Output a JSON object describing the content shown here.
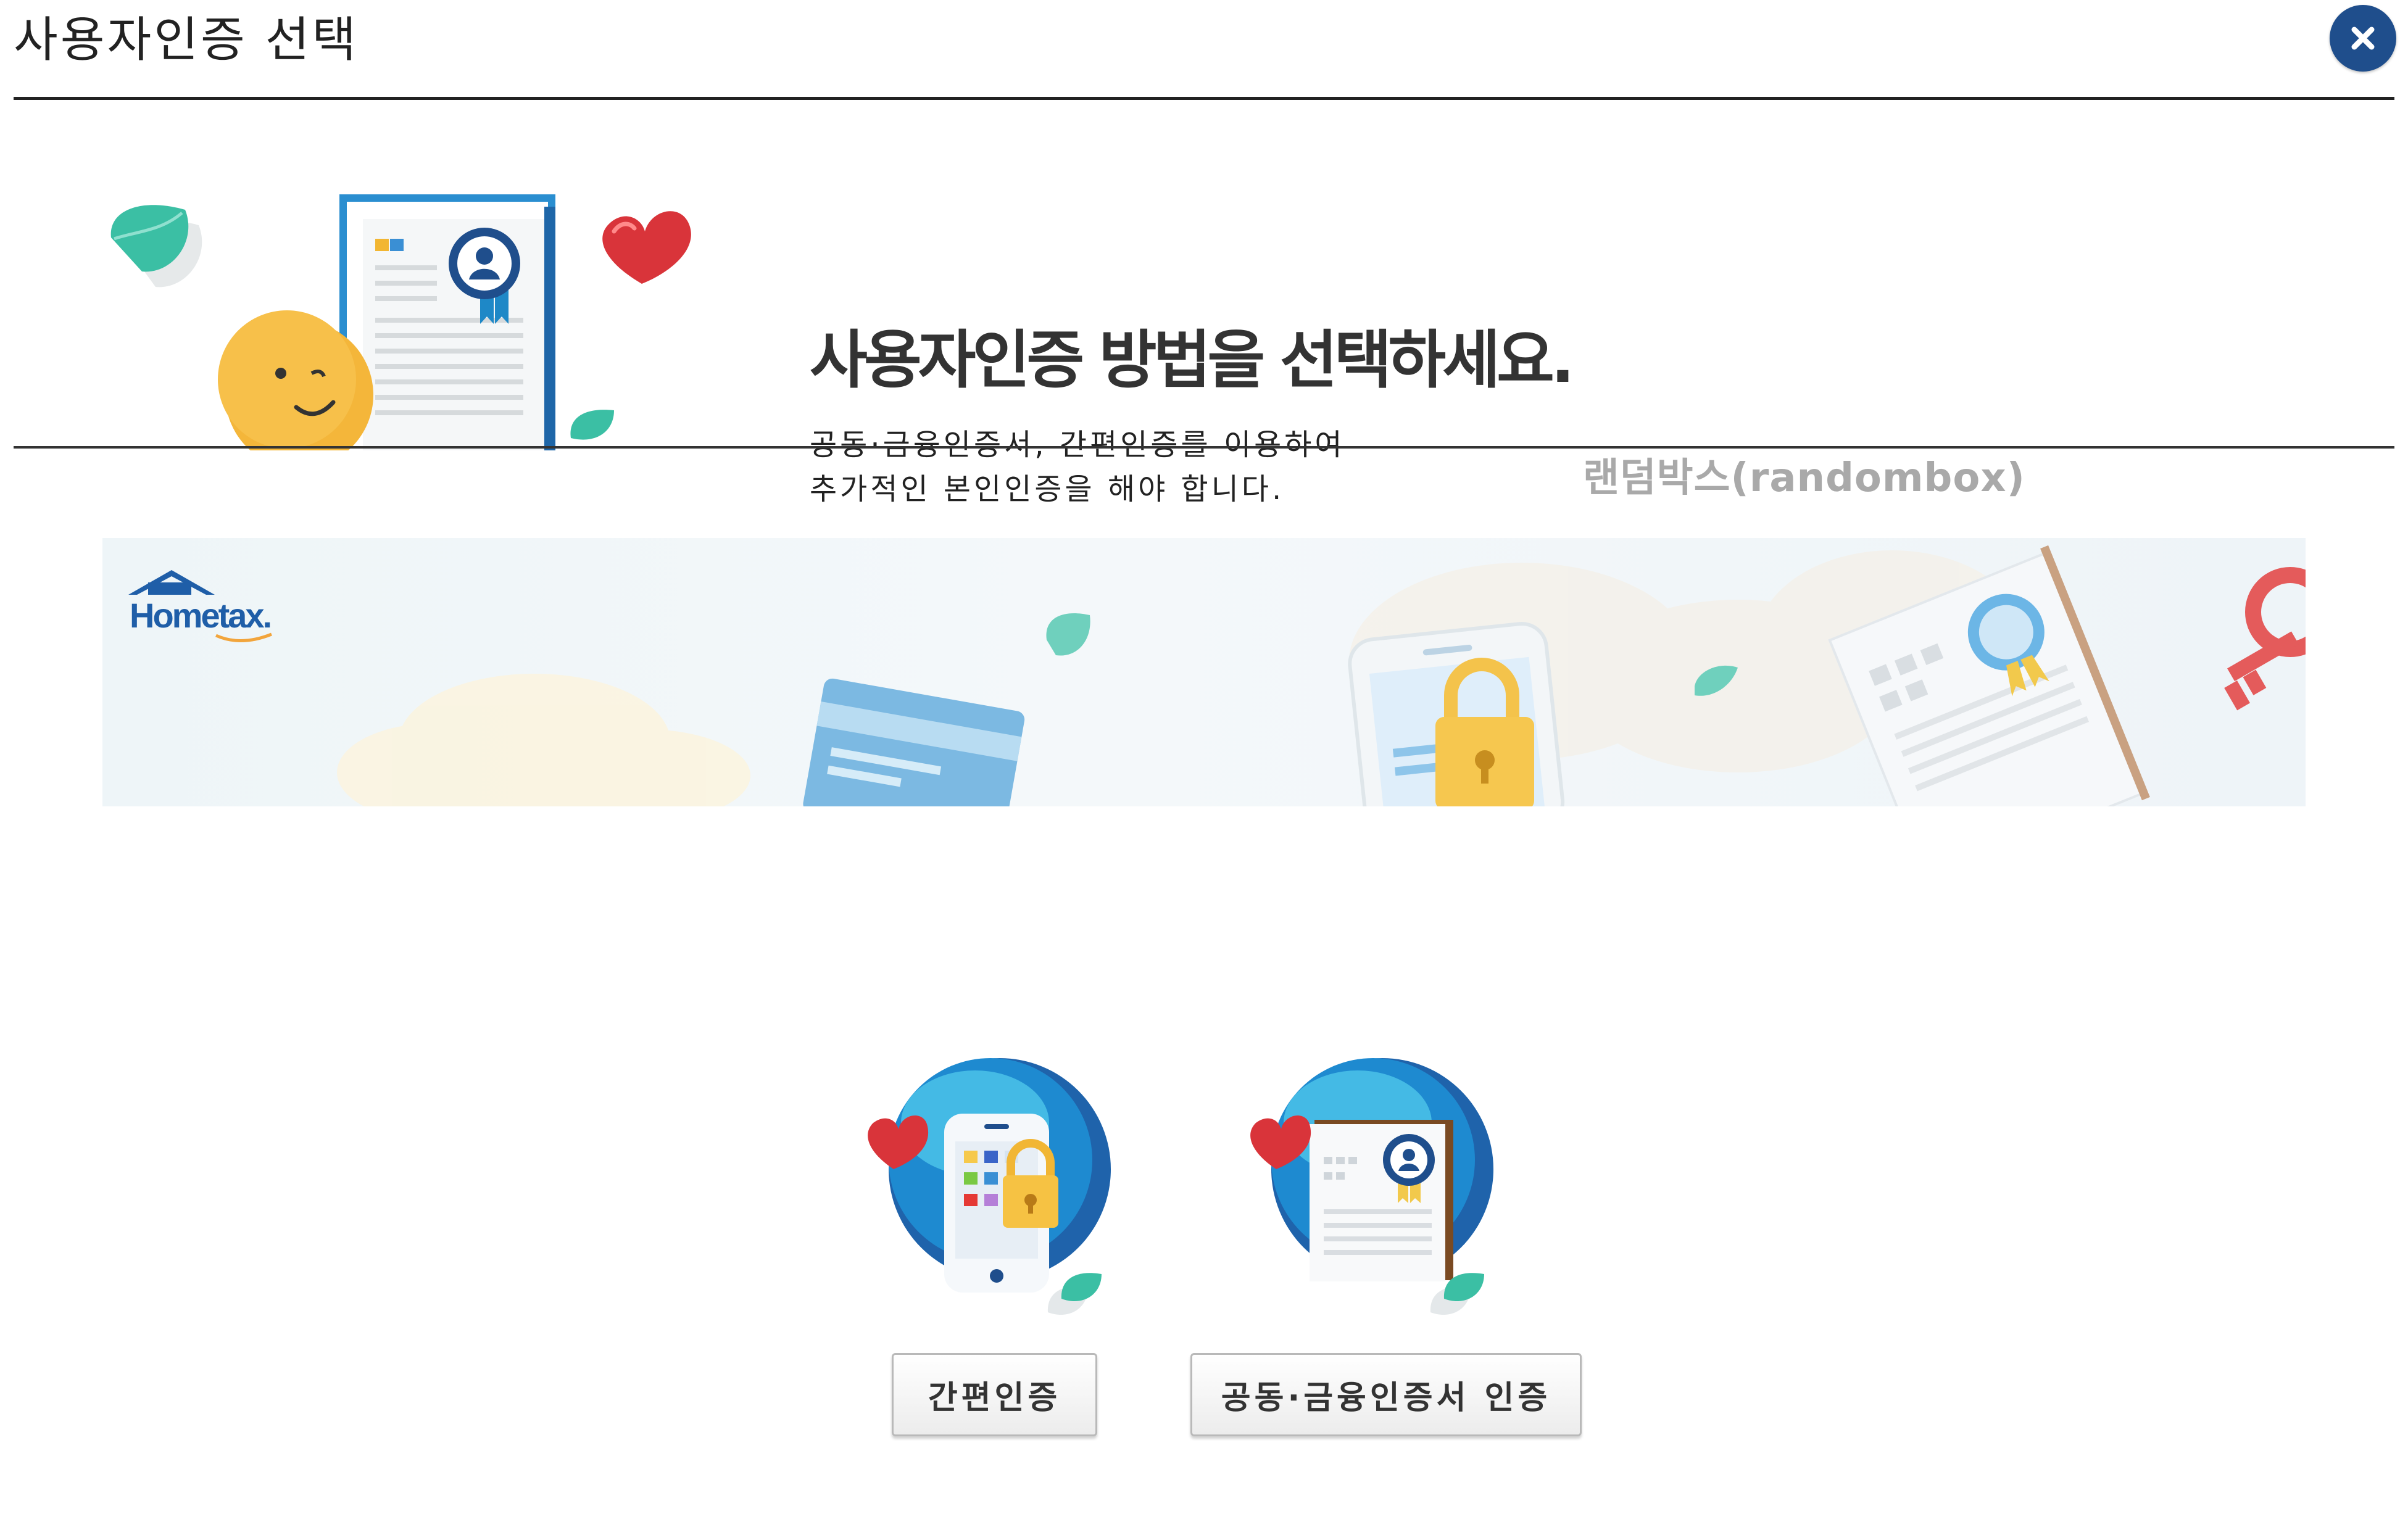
{
  "header": {
    "title": "사용자인증 선택",
    "close_icon": "close-icon"
  },
  "intro": {
    "heading": "사용자인증 방법을 선택하세요.",
    "description_line1": "공동·금융인증서, 간편인증를 이용하여",
    "description_line2": "추가적인 본인인증을 해야 합니다.",
    "watermark": "랜덤박스(randombox)"
  },
  "banner": {
    "logo_text": "Hometax."
  },
  "options": {
    "simple_auth_label": "간편인증",
    "certificate_auth_label": "공동·금융인증서 인증"
  },
  "colors": {
    "close_button": "#1f4e8c",
    "accent_blue": "#1e88c7",
    "heart_red": "#d9343a",
    "leaf_green": "#3bbfa4"
  }
}
